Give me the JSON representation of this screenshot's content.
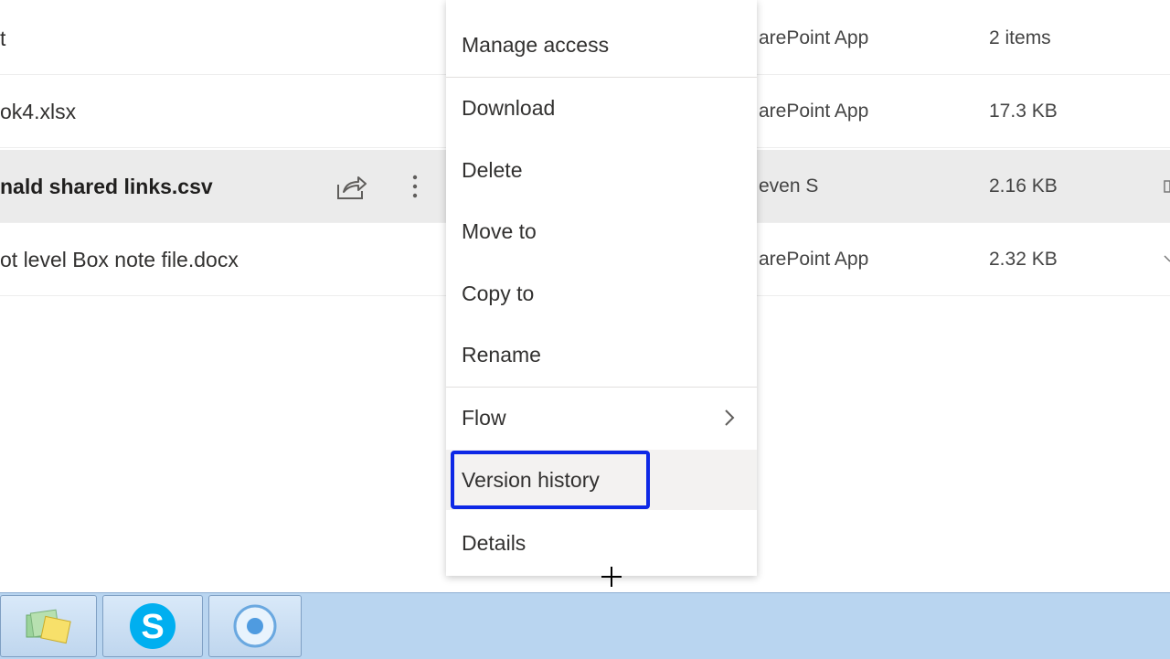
{
  "files": [
    {
      "name": "t",
      "modified_by": "arePoint App",
      "size": "2 items",
      "selected": false
    },
    {
      "name": "ok4.xlsx",
      "modified_by": "arePoint App",
      "size": "17.3 KB",
      "selected": false
    },
    {
      "name": "nald shared links.csv",
      "modified_by": "even S",
      "size": "2.16 KB",
      "selected": true
    },
    {
      "name": "ot level Box note file.docx",
      "modified_by": "arePoint App",
      "size": "2.32 KB",
      "selected": false
    }
  ],
  "context_menu": {
    "items": [
      {
        "label": "Manage access"
      },
      {
        "label": "Download"
      },
      {
        "label": "Delete"
      },
      {
        "label": "Move to"
      },
      {
        "label": "Copy to"
      },
      {
        "label": "Rename"
      },
      {
        "label": "Flow",
        "has_submenu": true
      },
      {
        "label": "Version history",
        "highlighted": true
      },
      {
        "label": "Details"
      }
    ]
  },
  "icons": {
    "share": "share-icon",
    "more": "more-vertical-icon",
    "chevron": "chevron-right-icon",
    "cursor": "crosshair-cursor-icon"
  },
  "taskbar": {
    "apps": [
      "file-explorer-icon",
      "skype-icon",
      "media-app-icon"
    ]
  },
  "colors": {
    "highlight_border": "#0d28e6",
    "selected_row": "#ebebeb",
    "skype_blue": "#00aff0",
    "taskbar": "#b9d5f0"
  }
}
